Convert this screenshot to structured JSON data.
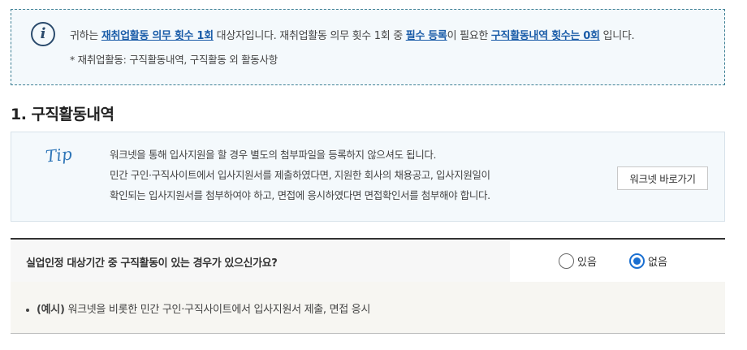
{
  "notice": {
    "icon": "info-icon",
    "line1": {
      "part1": "귀하는 ",
      "em1": "재취업활동 의무 횟수 1회",
      "part2": " 대상자입니다. 재취업활동 의무 횟수 1회 중 ",
      "em2": "필수 등록",
      "part3": "이 필요한 ",
      "em3": "구직활동내역 횟수는 0회",
      "part4": " 입니다."
    },
    "line2": "* 재취업활동: 구직활동내역, 구직활동 외 활동사항"
  },
  "section": {
    "title": "1. 구직활동내역"
  },
  "tip": {
    "label": "Tip",
    "line1": "워크넷을 통해 입사지원을 할 경우 별도의 첨부파일을 등록하지 않으셔도 됩니다.",
    "line2": "민간 구인·구직사이트에서 입사지원서를 제출하였다면, 지원한 회사의 채용공고, 입사지원일이",
    "line3": "확인되는 입사지원서를 첨부하여야 하고, 면접에 응시하였다면 면접확인서를 첨부해야 합니다.",
    "button": "워크넷 바로가기"
  },
  "question": {
    "text": "실업인정 대상기간 중 구직활동이 있는 경우가 있으신가요?",
    "options": [
      {
        "label": "있음",
        "checked": false
      },
      {
        "label": "없음",
        "checked": true
      }
    ]
  },
  "example": {
    "prefix": "(예시)",
    "text": " 워크넷을 비롯한 민간 구인·구직사이트에서 입사지원서 제출, 면접 응시"
  },
  "colors": {
    "accent": "#1a5ca8",
    "radio_checked": "#1a6fd1",
    "tip_label": "#2f76b8"
  }
}
